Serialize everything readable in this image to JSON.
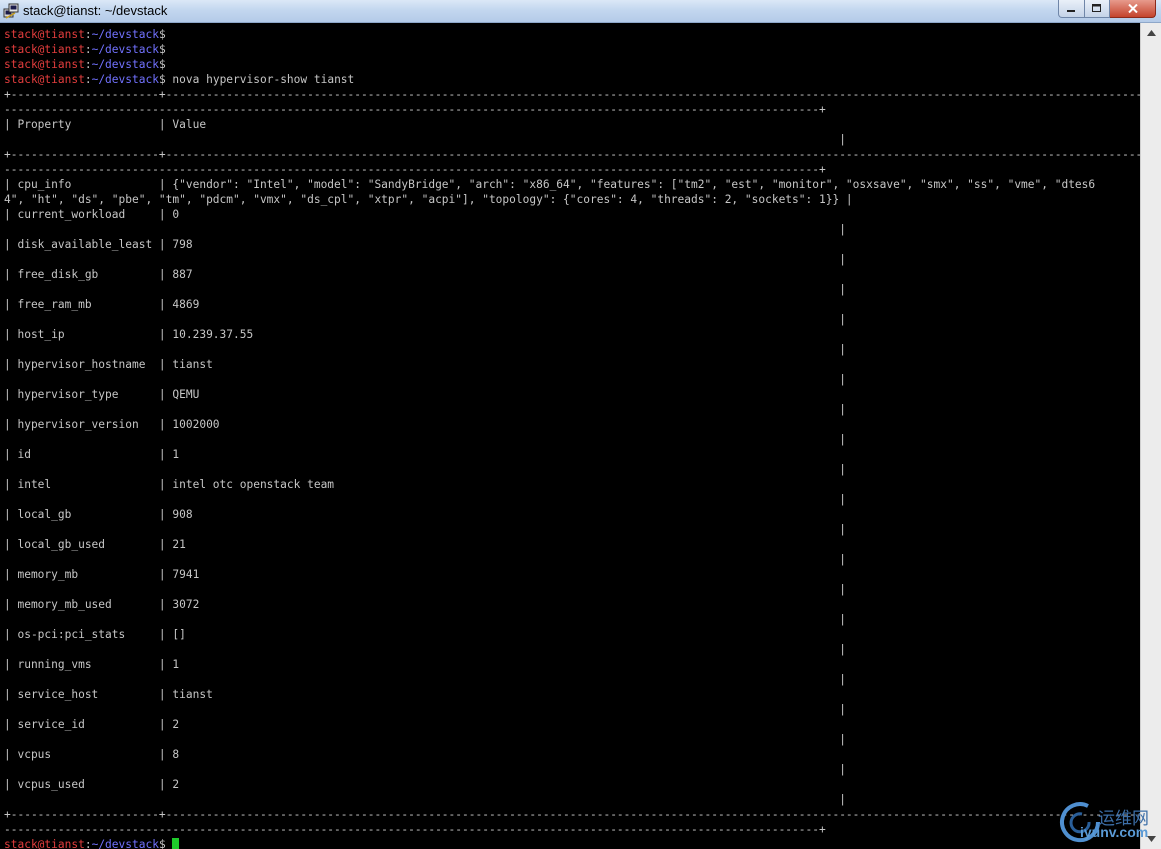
{
  "window": {
    "title": "stack@tianst: ~/devstack"
  },
  "prompt": {
    "user": "stack@tianst",
    "sep": ":",
    "dir": "~/devstack",
    "sym": "$"
  },
  "command": " nova hypervisor-show tianst",
  "table": {
    "border_long": "+----------------------+------------------------------------------------------------------------------------------------------------------------------------------------------------",
    "border_short": "-------------------------------------------------------------------------------------------------------------------------+",
    "header": "| Property             | Value",
    "pipe_col": "                                                                                                                            |",
    "cpu_info_1": "| cpu_info             | {\"vendor\": \"Intel\", \"model\": \"SandyBridge\", \"arch\": \"x86_64\", \"features\": [\"tm2\", \"est\", \"monitor\", \"osxsave\", \"smx\", \"ss\", \"vme\", \"dtes6",
    "cpu_info_2": "4\", \"ht\", \"ds\", \"pbe\", \"tm\", \"pdcm\", \"vmx\", \"ds_cpl\", \"xtpr\", \"acpi\"], \"topology\": {\"cores\": 4, \"threads\": 2, \"sockets\": 1}} |",
    "rows": [
      "| current_workload     | 0",
      "| disk_available_least | 798",
      "| free_disk_gb         | 887",
      "| free_ram_mb          | 4869",
      "| host_ip              | 10.239.37.55",
      "| hypervisor_hostname  | tianst",
      "| hypervisor_type      | QEMU",
      "| hypervisor_version   | 1002000",
      "| id                   | 1",
      "| intel                | intel otc openstack team",
      "| local_gb             | 908",
      "| local_gb_used        | 21",
      "| memory_mb            | 7941",
      "| memory_mb_used       | 3072",
      "| os-pci:pci_stats     | []",
      "| running_vms          | 1",
      "| service_host         | tianst",
      "| service_id           | 2",
      "| vcpus                | 8",
      "| vcpus_used           | 2"
    ]
  },
  "watermark": {
    "text1": "运维网",
    "text2": "iyunv.com"
  }
}
